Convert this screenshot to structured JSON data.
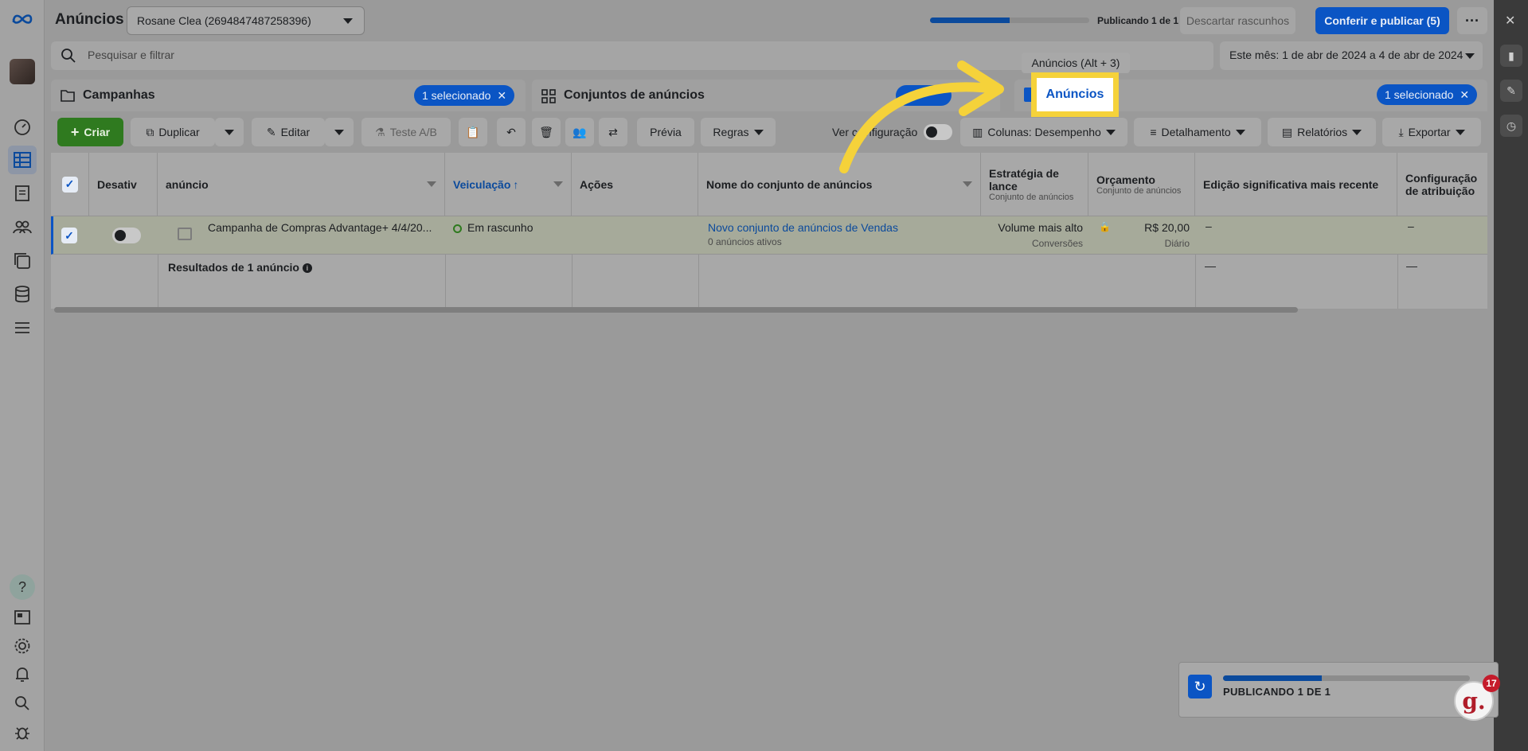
{
  "header": {
    "title": "Anúncios",
    "account": "Rosane Clea (2694847487258396)",
    "progress": 0.5,
    "publishing_status": "Publicando 1 de 1",
    "discard_label": "Descartar rascunhos",
    "publish_label": "Conferir e publicar (5)",
    "more_label": "···"
  },
  "search": {
    "placeholder": "Pesquisar e filtrar",
    "date_range": "Este mês: 1 de abr de 2024 a 4 de abr de 2024"
  },
  "tabs": {
    "campaigns": {
      "label": "Campanhas",
      "selected": "1 selecionado"
    },
    "adsets": {
      "label": "Conjuntos de anúncios"
    },
    "ads": {
      "label": "Anúncios",
      "selected": "1 selecionado",
      "tooltip": "Anúncios (Alt + 3)"
    }
  },
  "toolbar": {
    "create": "Criar",
    "duplicate": "Duplicar",
    "edit": "Editar",
    "ab_test": "Teste A/B",
    "preview": "Prévia",
    "rules": "Regras",
    "view_config_a": "Ver c",
    "view_config_b": "nfiguração",
    "columns": "Colunas: Desempenho",
    "breakdown": "Detalhamento",
    "reports": "Relatórios",
    "export": "Exportar"
  },
  "table": {
    "headers": {
      "off": "Desativ",
      "ad": "anúncio",
      "delivery": "Veiculação",
      "actions": "Ações",
      "adset_name": "Nome do conjunto de anúncios",
      "bid_strategy": "Estratégia de lance",
      "bid_strategy_sub": "Conjunto de anúncios",
      "budget": "Orçamento",
      "budget_sub": "Conjunto de anúncios",
      "last_edit": "Edição significativa mais recente",
      "attribution": "Configuração de atribuição"
    },
    "row": {
      "ad_name": "Campanha de Compras Advantage+ 4/4/20...",
      "delivery": "Em rascunho",
      "adset_name": "Novo conjunto de anúncios de Vendas",
      "adset_sub": "0 anúncios ativos",
      "bid_strategy": "Volume mais alto",
      "bid_strategy_sub": "Conversões",
      "budget": "R$ 20,00",
      "budget_sub": "Diário",
      "last_edit": "–",
      "attribution": "–"
    },
    "results": {
      "label": "Resultados de 1 anúncio",
      "last_edit": "—",
      "attribution": "—"
    }
  },
  "publishing_card": {
    "label": "PUBLICANDO 1 DE 1",
    "progress": 0.4,
    "badge_letter": "g.",
    "badge_count": "17"
  },
  "icons": {
    "rail": [
      "meta-logo-icon",
      "dashboard-icon",
      "table-icon",
      "pages-icon",
      "audience-icon",
      "creative-icon",
      "billing-icon",
      "menu-icon",
      "help-icon",
      "news-icon",
      "settings-icon",
      "bell-icon",
      "search-icon",
      "bug-icon"
    ],
    "right": [
      "close-icon",
      "chart-icon",
      "pencil-icon",
      "clock-icon"
    ]
  },
  "colors": {
    "accent": "#0b55c4",
    "create": "#2f7a1f",
    "highlight": "#f5d23a"
  }
}
